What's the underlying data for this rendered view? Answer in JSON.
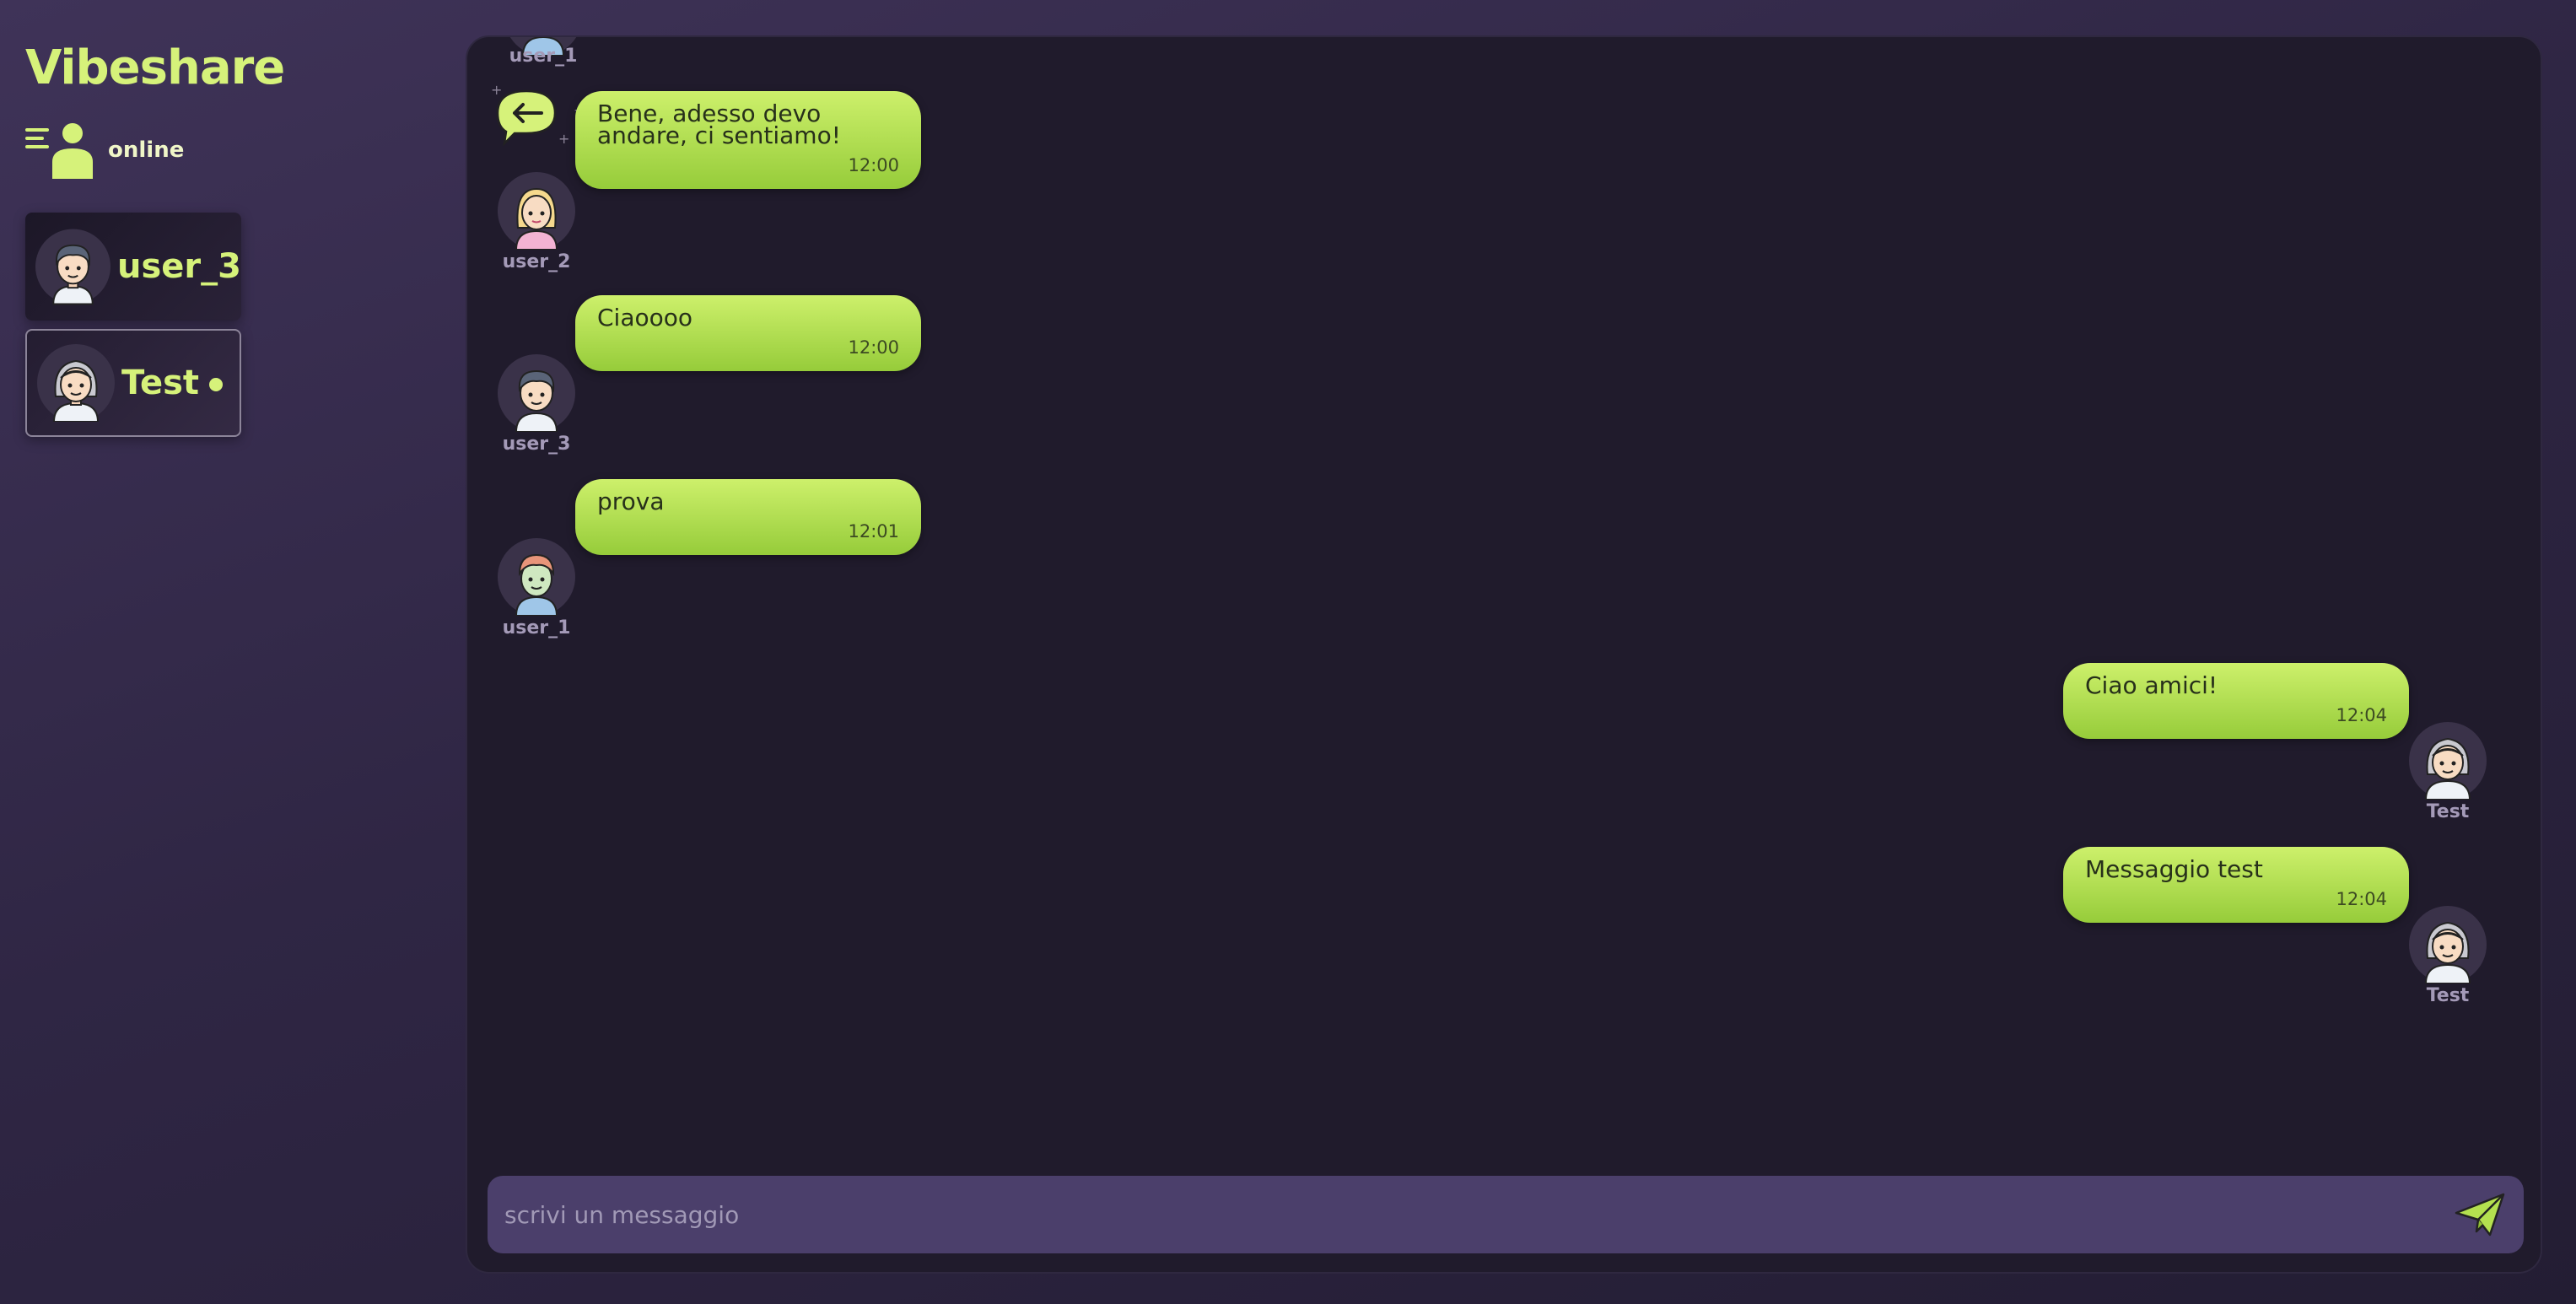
{
  "app": {
    "brand": "Vibeshare"
  },
  "sidebar": {
    "online_label": "online",
    "users": [
      {
        "name": "user_3",
        "active": false,
        "avatar": "boy-avatar"
      },
      {
        "name": "Test",
        "active": true,
        "avatar": "grandma-avatar"
      }
    ]
  },
  "chat": {
    "top_partial_name": "user_1",
    "messages": [
      {
        "text": "Bene, adesso devo andare, ci sentiamo!",
        "time": "12:00",
        "author": "user_2",
        "side": "left"
      },
      {
        "text": "Ciaoooo",
        "time": "12:00",
        "author": "user_3",
        "side": "left"
      },
      {
        "text": "prova",
        "time": "12:01",
        "author": "user_1",
        "side": "left"
      },
      {
        "text": "Ciao amici!",
        "time": "12:04",
        "author": "Test",
        "side": "right"
      },
      {
        "text": "Messaggio test",
        "time": "12:04",
        "author": "Test",
        "side": "right"
      }
    ]
  },
  "composer": {
    "placeholder": "scrivi un messaggio",
    "value": ""
  },
  "colors": {
    "accent": "#d6f27a",
    "bubble": "#b4e04f",
    "panel": "#201b2c",
    "input": "#4b3f6b"
  }
}
